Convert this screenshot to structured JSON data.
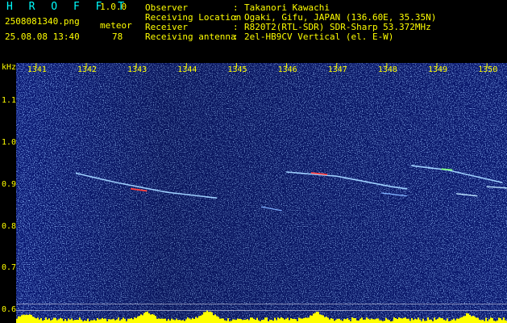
{
  "header": {
    "app_name": "H R O F F T",
    "version": "1.0.0",
    "filename": "2508081340.png",
    "datetime": "25.08.08 13:40",
    "meteor_label": "meteor",
    "meteor_count": "78",
    "info": [
      {
        "label": "Observer",
        "value": "Takanori Kawachi"
      },
      {
        "label": "Receiving Location",
        "value": "Ogaki, Gifu, JAPAN (136.60E, 35.35N)"
      },
      {
        "label": "Receiver",
        "value": "R820T2(RTL-SDR) SDR-Sharp 53.372MHz"
      },
      {
        "label": "Receiving antenna",
        "value": "2el-HB9CV Vertical (el. E-W)"
      }
    ]
  },
  "spectrogram": {
    "unit": "kHz",
    "colors": {
      "background": "#0a1a7a",
      "noise": "#3a6cff",
      "trace_hot": "#ff3030",
      "trace": "#9fd0ff",
      "level": "#ffff00",
      "labels": "#ffff00"
    }
  },
  "chart_data": {
    "type": "heatmap",
    "title": "",
    "ylabel": "kHz",
    "xlabel": "",
    "x_ticks": [
      "1341",
      "1342",
      "1343",
      "1344",
      "1345",
      "1346",
      "1347",
      "1348",
      "1349",
      "1350"
    ],
    "y_ticks": [
      "1.1",
      "1.0",
      "0.9",
      "0.8",
      "0.7",
      "0.6"
    ],
    "ylim": [
      0.57,
      1.19
    ],
    "xlim": [
      1340.6,
      1350.4
    ]
  }
}
